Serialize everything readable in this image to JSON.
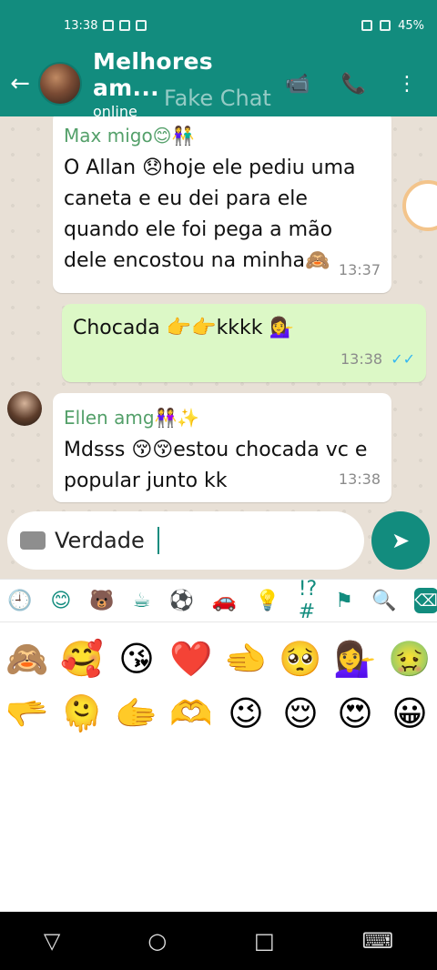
{
  "status_bar": {
    "time": "13:38",
    "battery": "45%"
  },
  "header": {
    "title": "Melhores am...",
    "subtitle": "online",
    "watermark": "Fake Chat"
  },
  "messages": [
    {
      "direction": "in",
      "sender": "Max migo😊👫",
      "text": "O Allan 😞hoje ele pediu uma caneta e eu dei para ele quando ele foi pega a mão dele encostou na minha🙈",
      "time": "13:37"
    },
    {
      "direction": "out",
      "text": "Chocada 👉👉kkkk 💁‍♀️",
      "time": "13:38",
      "ticks": "✓✓"
    },
    {
      "direction": "in",
      "sender": "Ellen amg👭✨",
      "text": "Mdsss 😚😚estou chocada vc e popular junto kk",
      "time": "13:38"
    }
  ],
  "composer": {
    "value": "Verdade",
    "send_icon": "send-icon"
  },
  "emoji_tabs": [
    "🕘",
    "😊",
    "🐻",
    "☕",
    "⚽",
    "🚗",
    "💡",
    "!?#",
    "⚑",
    "🔍",
    "⌫"
  ],
  "emojis": [
    [
      "🙈",
      "🥰",
      "😘",
      "❤️",
      "🫲",
      "🥺",
      "💁‍♀️",
      "🤢"
    ],
    [
      "🫳",
      "🫠",
      "🫱",
      "🫶",
      "😉",
      "😌",
      "😍",
      "😀"
    ]
  ],
  "navbar": [
    "▽",
    "○",
    "□",
    "⌨"
  ],
  "colors": {
    "primary": "#128C7E",
    "in_bubble": "#ffffff",
    "out_bubble": "#dcf8c6",
    "chat_bg": "#e8e0d6"
  }
}
